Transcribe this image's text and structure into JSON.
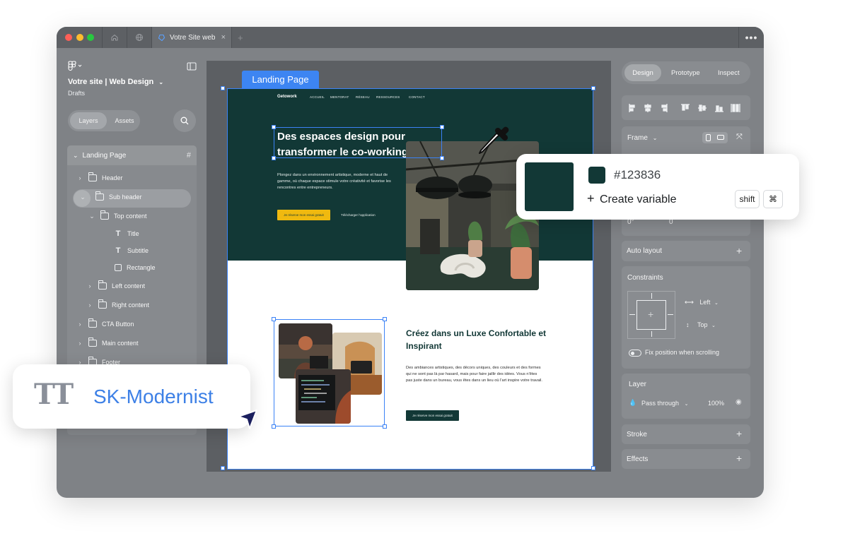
{
  "browser": {
    "active_tab_title": "Votre Site web",
    "close_glyph": "×",
    "new_tab_glyph": "+",
    "more_glyph": "•••"
  },
  "left_panel": {
    "file_title": "Votre site | Web Design",
    "file_location": "Drafts",
    "tabs": {
      "layers": "Layers",
      "assets": "Assets"
    },
    "layers_root": "Landing Page",
    "layers": [
      {
        "label": "Header",
        "type": "folder",
        "expand": "›"
      },
      {
        "label": "Sub header",
        "type": "folder",
        "expand": "⌄"
      },
      {
        "label": "Top content",
        "type": "folder",
        "expand": "⌄"
      },
      {
        "label": "Title",
        "type": "text"
      },
      {
        "label": "Subtitle",
        "type": "text"
      },
      {
        "label": "Rectangle",
        "type": "rect"
      },
      {
        "label": "Left content",
        "type": "folder",
        "expand": "›"
      },
      {
        "label": "Right content",
        "type": "folder",
        "expand": "›"
      },
      {
        "label": "CTA Button",
        "type": "folder",
        "expand": "›"
      },
      {
        "label": "Main content",
        "type": "folder",
        "expand": "›"
      },
      {
        "label": "Footer",
        "type": "folder",
        "expand": "›"
      }
    ]
  },
  "canvas": {
    "frame_label": "Landing Page",
    "site": {
      "logo": "Getowork",
      "nav": [
        "ACCUEIL",
        "MENTORAT",
        "RÉSEAU",
        "RESSOURCES",
        "CONTACT"
      ],
      "hero_title": "Des espaces design pour transformer le co-working.",
      "hero_subtitle": "Plongez dans un environnement artistique, moderne et haut de gamme, où chaque espace stimule votre créativité et favorise les rencontres entre entrepreneurs.",
      "hero_cta": "Je réserve mon essai gratuit",
      "hero_link": "Télécharger l'application",
      "section2_title": "Créez dans un Luxe Confortable et Inspirant",
      "section2_body": "Des ambiances artistiques, des décors uniques, des couleurs et des formes qui ne sont pas là par hasard, mais pour faire jaillir des idées. Vous n'êtes pas juste dans un bureau, vous êtes dans un lieu où l'art inspire votre travail.",
      "section2_cta": "Je réserve mon essai gratuit"
    }
  },
  "right_panel": {
    "modes": [
      "Design",
      "Prototype",
      "Inspect"
    ],
    "frame_label": "Frame",
    "rotation": "0°",
    "radius": "0",
    "auto_layout": "Auto layout",
    "constraints": "Constraints",
    "constraint_h": "Left",
    "constraint_v": "Top",
    "fix_position": "Fix position when scrolling",
    "layer_title": "Layer",
    "blend_mode": "Pass through",
    "opacity": "100%",
    "stroke": "Stroke",
    "effects": "Effects"
  },
  "color_popup": {
    "hex": "#123836",
    "create_variable": "Create variable",
    "shortcut_1": "shift",
    "shortcut_2": "⌘",
    "swatch_color": "#123836"
  },
  "font_popup": {
    "glyph": "TT",
    "font_name": "SK-Modernist"
  },
  "colors": {
    "brand_dark_green": "#123836",
    "cta_yellow": "#F0B90F",
    "selection_blue": "#3B82F6"
  }
}
